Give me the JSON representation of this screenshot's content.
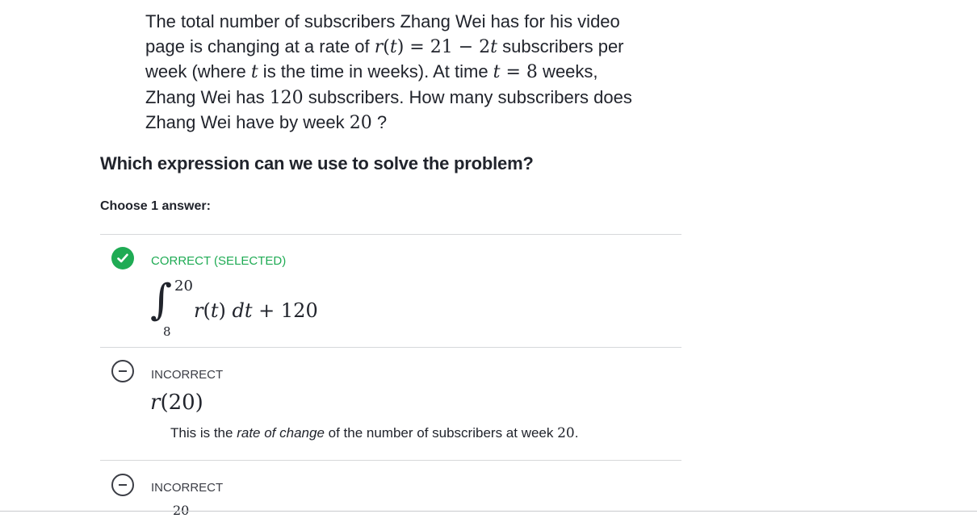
{
  "problem": {
    "line1": "The total number of subscribers Zhang Wei has for his video",
    "line2_pre": "page is changing at a rate of ",
    "line2_math": "r(t) = 21 − 2t",
    "line2_post": " subscribers per",
    "line3_pre": "week (where ",
    "line3_math_t": "t",
    "line3_mid": " is the time in weeks). At time ",
    "line3_math_eq": "t = 8",
    "line3_post": " weeks,",
    "line4_pre": "Zhang Wei has ",
    "line4_math": "120",
    "line4_post": " subscribers. How many subscribers does",
    "line5_pre": "Zhang Wei have by week ",
    "line5_math": "20",
    "line5_post": " ?"
  },
  "question": "Which expression can we use to solve the problem?",
  "choose_label": "Choose 1 answer:",
  "answers": [
    {
      "status": "CORRECT (SELECTED)",
      "icon": "checkmark-icon",
      "integral_upper": "20",
      "integral_lower": "8",
      "integral_body_fn": "r(t) dt + 120"
    },
    {
      "status": "INCORRECT",
      "icon": "minus-icon",
      "expression": "r(20)",
      "feedback_pre": "This is the ",
      "feedback_em": "rate of change",
      "feedback_mid": " of the number of subscribers at week ",
      "feedback_num": "20",
      "feedback_post": "."
    },
    {
      "status": "INCORRECT",
      "icon": "minus-icon",
      "partial_expression": "20"
    }
  ],
  "colors": {
    "correct_green": "#1fab54",
    "text": "#21242c",
    "divider": "#d6d8da",
    "incorrect_gray": "#3b3d45"
  }
}
